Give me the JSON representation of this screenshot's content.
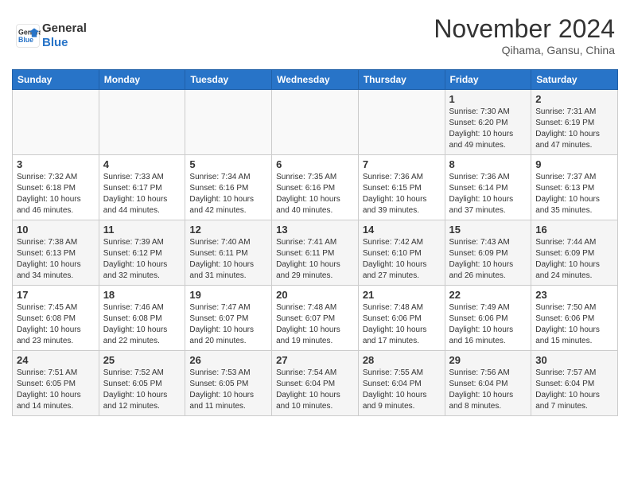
{
  "header": {
    "logo_line1": "General",
    "logo_line2": "Blue",
    "month_title": "November 2024",
    "subtitle": "Qihama, Gansu, China"
  },
  "weekdays": [
    "Sunday",
    "Monday",
    "Tuesday",
    "Wednesday",
    "Thursday",
    "Friday",
    "Saturday"
  ],
  "weeks": [
    [
      {
        "day": "",
        "content": ""
      },
      {
        "day": "",
        "content": ""
      },
      {
        "day": "",
        "content": ""
      },
      {
        "day": "",
        "content": ""
      },
      {
        "day": "",
        "content": ""
      },
      {
        "day": "1",
        "content": "Sunrise: 7:30 AM\nSunset: 6:20 PM\nDaylight: 10 hours and 49 minutes."
      },
      {
        "day": "2",
        "content": "Sunrise: 7:31 AM\nSunset: 6:19 PM\nDaylight: 10 hours and 47 minutes."
      }
    ],
    [
      {
        "day": "3",
        "content": "Sunrise: 7:32 AM\nSunset: 6:18 PM\nDaylight: 10 hours and 46 minutes."
      },
      {
        "day": "4",
        "content": "Sunrise: 7:33 AM\nSunset: 6:17 PM\nDaylight: 10 hours and 44 minutes."
      },
      {
        "day": "5",
        "content": "Sunrise: 7:34 AM\nSunset: 6:16 PM\nDaylight: 10 hours and 42 minutes."
      },
      {
        "day": "6",
        "content": "Sunrise: 7:35 AM\nSunset: 6:16 PM\nDaylight: 10 hours and 40 minutes."
      },
      {
        "day": "7",
        "content": "Sunrise: 7:36 AM\nSunset: 6:15 PM\nDaylight: 10 hours and 39 minutes."
      },
      {
        "day": "8",
        "content": "Sunrise: 7:36 AM\nSunset: 6:14 PM\nDaylight: 10 hours and 37 minutes."
      },
      {
        "day": "9",
        "content": "Sunrise: 7:37 AM\nSunset: 6:13 PM\nDaylight: 10 hours and 35 minutes."
      }
    ],
    [
      {
        "day": "10",
        "content": "Sunrise: 7:38 AM\nSunset: 6:13 PM\nDaylight: 10 hours and 34 minutes."
      },
      {
        "day": "11",
        "content": "Sunrise: 7:39 AM\nSunset: 6:12 PM\nDaylight: 10 hours and 32 minutes."
      },
      {
        "day": "12",
        "content": "Sunrise: 7:40 AM\nSunset: 6:11 PM\nDaylight: 10 hours and 31 minutes."
      },
      {
        "day": "13",
        "content": "Sunrise: 7:41 AM\nSunset: 6:11 PM\nDaylight: 10 hours and 29 minutes."
      },
      {
        "day": "14",
        "content": "Sunrise: 7:42 AM\nSunset: 6:10 PM\nDaylight: 10 hours and 27 minutes."
      },
      {
        "day": "15",
        "content": "Sunrise: 7:43 AM\nSunset: 6:09 PM\nDaylight: 10 hours and 26 minutes."
      },
      {
        "day": "16",
        "content": "Sunrise: 7:44 AM\nSunset: 6:09 PM\nDaylight: 10 hours and 24 minutes."
      }
    ],
    [
      {
        "day": "17",
        "content": "Sunrise: 7:45 AM\nSunset: 6:08 PM\nDaylight: 10 hours and 23 minutes."
      },
      {
        "day": "18",
        "content": "Sunrise: 7:46 AM\nSunset: 6:08 PM\nDaylight: 10 hours and 22 minutes."
      },
      {
        "day": "19",
        "content": "Sunrise: 7:47 AM\nSunset: 6:07 PM\nDaylight: 10 hours and 20 minutes."
      },
      {
        "day": "20",
        "content": "Sunrise: 7:48 AM\nSunset: 6:07 PM\nDaylight: 10 hours and 19 minutes."
      },
      {
        "day": "21",
        "content": "Sunrise: 7:48 AM\nSunset: 6:06 PM\nDaylight: 10 hours and 17 minutes."
      },
      {
        "day": "22",
        "content": "Sunrise: 7:49 AM\nSunset: 6:06 PM\nDaylight: 10 hours and 16 minutes."
      },
      {
        "day": "23",
        "content": "Sunrise: 7:50 AM\nSunset: 6:06 PM\nDaylight: 10 hours and 15 minutes."
      }
    ],
    [
      {
        "day": "24",
        "content": "Sunrise: 7:51 AM\nSunset: 6:05 PM\nDaylight: 10 hours and 14 minutes."
      },
      {
        "day": "25",
        "content": "Sunrise: 7:52 AM\nSunset: 6:05 PM\nDaylight: 10 hours and 12 minutes."
      },
      {
        "day": "26",
        "content": "Sunrise: 7:53 AM\nSunset: 6:05 PM\nDaylight: 10 hours and 11 minutes."
      },
      {
        "day": "27",
        "content": "Sunrise: 7:54 AM\nSunset: 6:04 PM\nDaylight: 10 hours and 10 minutes."
      },
      {
        "day": "28",
        "content": "Sunrise: 7:55 AM\nSunset: 6:04 PM\nDaylight: 10 hours and 9 minutes."
      },
      {
        "day": "29",
        "content": "Sunrise: 7:56 AM\nSunset: 6:04 PM\nDaylight: 10 hours and 8 minutes."
      },
      {
        "day": "30",
        "content": "Sunrise: 7:57 AM\nSunset: 6:04 PM\nDaylight: 10 hours and 7 minutes."
      }
    ]
  ]
}
